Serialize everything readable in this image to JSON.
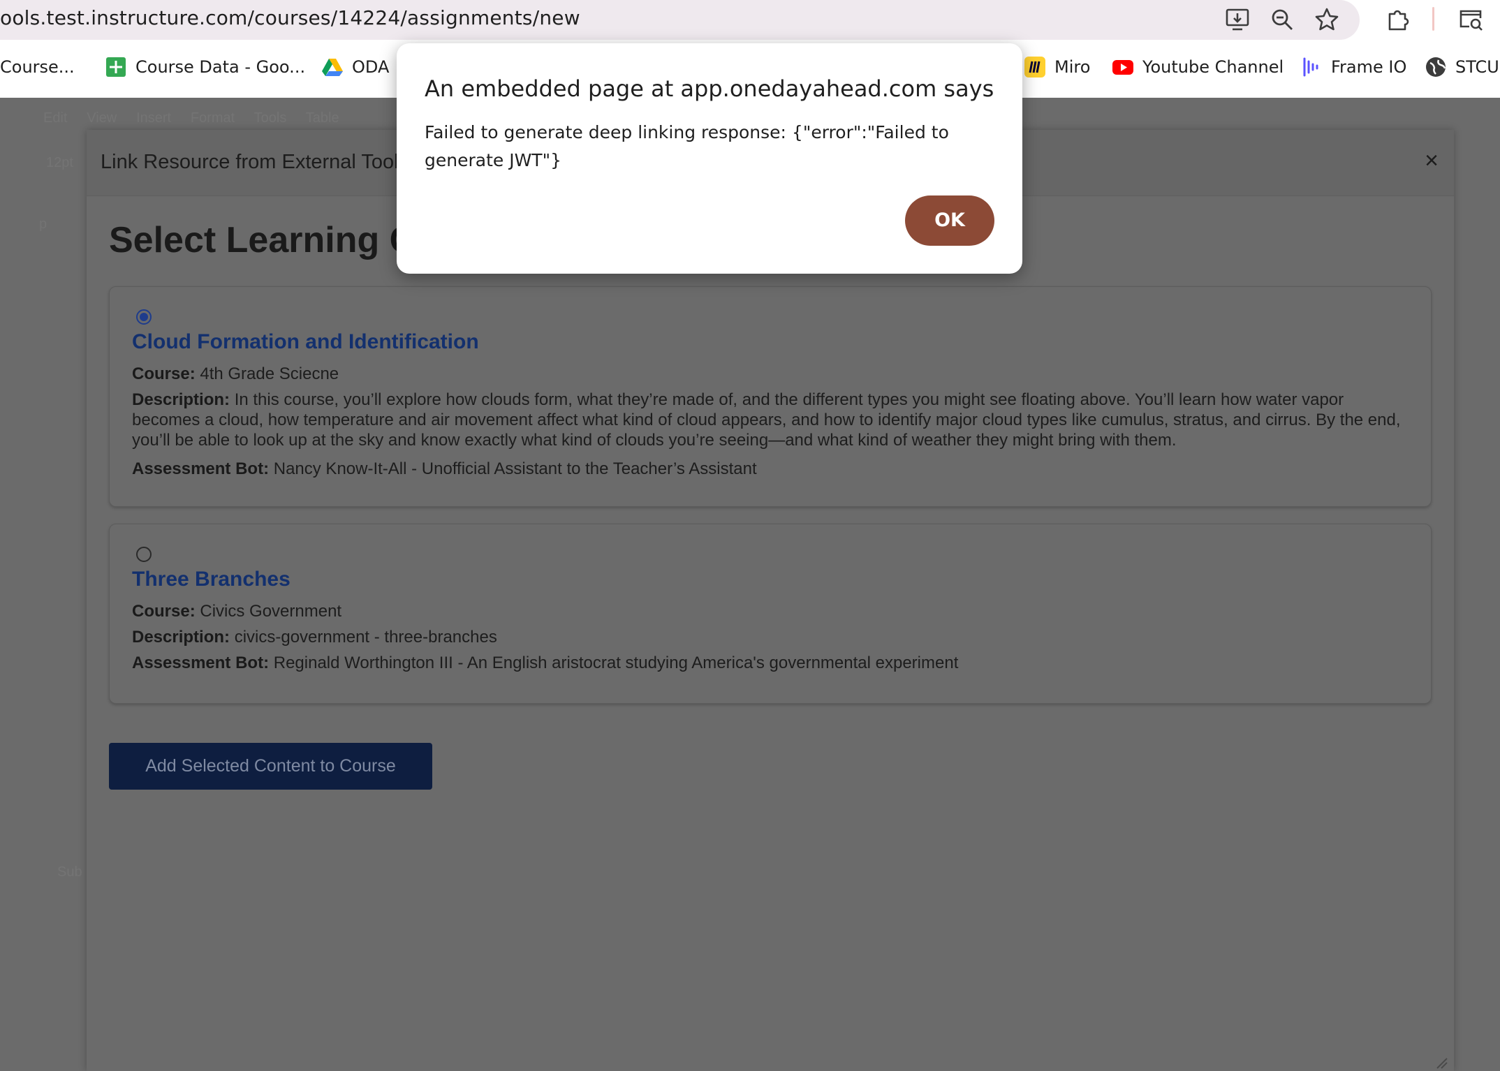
{
  "browser": {
    "url": "ools.test.instructure.com/courses/14224/assignments/new",
    "bookmarks": [
      {
        "label": "Course...",
        "icon": "partial-favicon"
      },
      {
        "label": "Course Data - Goo...",
        "icon": "google-sheets-icon",
        "color": "#34a853"
      },
      {
        "label": "ODA",
        "icon": "google-drive-icon"
      },
      {
        "label": "Miro",
        "icon": "miro-icon",
        "color": "#ffd02f"
      },
      {
        "label": "Youtube Channel",
        "icon": "youtube-icon",
        "color": "#ff0000"
      },
      {
        "label": "Frame IO",
        "icon": "frame-io-icon",
        "color": "#6c63ff"
      },
      {
        "label": "STCU",
        "icon": "globe-icon"
      }
    ]
  },
  "background": {
    "menu": [
      "Edit",
      "View",
      "Insert",
      "Format",
      "Tools",
      "Table"
    ],
    "font_size": "12pt",
    "para": "p",
    "sub": "Sub"
  },
  "modal": {
    "title": "Link Resource from External Tool",
    "close": "×",
    "heading": "Select Learning C",
    "items": [
      {
        "selected": true,
        "title": "Cloud Formation and Identification",
        "course_label": "Course:",
        "course": "4th Grade Sciecne",
        "description_label": "Description:",
        "description": "In this course, you’ll explore how clouds form, what they’re made of, and the different types you might see floating above. You’ll learn how water vapor becomes a cloud, how temperature and air movement affect what kind of cloud appears, and how to identify major cloud types like cumulus, stratus, and cirrus. By the end, you’ll be able to look up at the sky and know exactly what kind of clouds you’re seeing—and what kind of weather they might bring with them.",
        "bot_label": "Assessment Bot:",
        "bot": "Nancy Know-It-All - Unofficial Assistant to the Teacher’s Assistant"
      },
      {
        "selected": false,
        "title": "Three Branches",
        "course_label": "Course:",
        "course": "Civics Government",
        "description_label": "Description:",
        "description": "civics-government - three-branches",
        "bot_label": "Assessment Bot:",
        "bot": "Reginald Worthington III - An English aristocrat studying America's governmental experiment"
      }
    ],
    "submit_label": "Add Selected Content to Course"
  },
  "alert": {
    "title": "An embedded page at app.onedayahead.com says",
    "message": "Failed to generate deep linking response: {\"error\":\"Failed to generate JWT\"}",
    "ok_label": "OK",
    "accent": "#8c4a36"
  }
}
